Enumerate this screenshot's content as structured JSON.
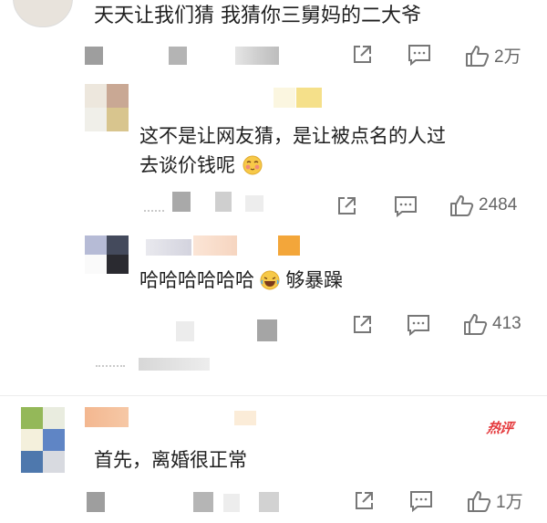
{
  "comments": [
    {
      "text": "天天让我们猜 我猜你三舅妈的二大爷",
      "likes": "2万"
    },
    {
      "text_line1": "这不是让网友猜，是让被点名的人过",
      "text_line2": "去谈价钱呢",
      "likes": "2484"
    },
    {
      "text_before": "哈哈哈哈哈哈",
      "text_after": "够暴躁",
      "likes": "413"
    },
    {
      "text": "首先，离婚很正常",
      "likes": "1万",
      "badge": "热评"
    }
  ],
  "icons": {
    "share": "share-icon",
    "comment": "comment-icon",
    "like": "thumbs-up-icon"
  },
  "colors": {
    "badge": "#e4393c",
    "icon": "#777777"
  }
}
